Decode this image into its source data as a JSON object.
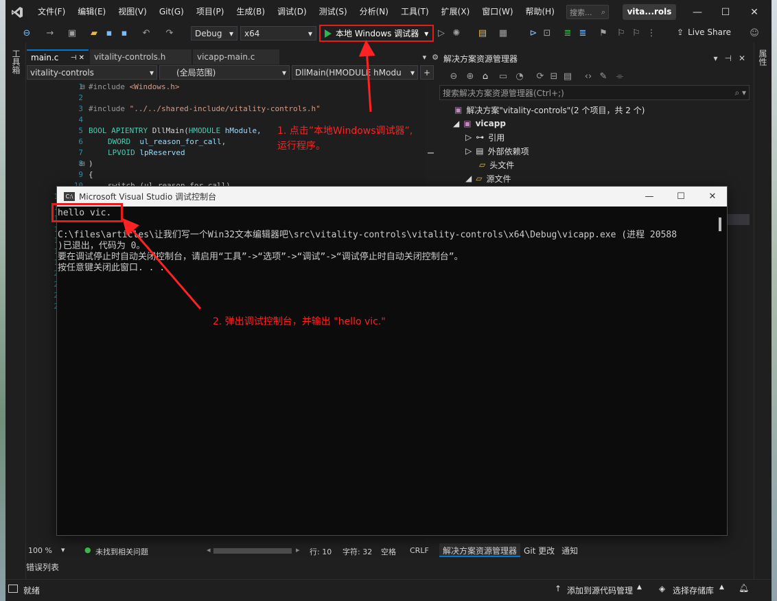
{
  "menu": [
    "文件(F)",
    "编辑(E)",
    "视图(V)",
    "Git(G)",
    "项目(P)",
    "生成(B)",
    "调试(D)",
    "测试(S)",
    "分析(N)",
    "工具(T)",
    "扩展(X)",
    "窗口(W)",
    "帮助(H)"
  ],
  "search_label": "搜索...",
  "title_tag": "vita...rols",
  "toolbar": {
    "config": "Debug",
    "platform": "x64",
    "run_label": "本地 Windows 调试器",
    "live_share": "Live Share"
  },
  "left_strip_label": "工具箱",
  "right_strip_label": "属性",
  "editor": {
    "tabs": [
      "main.c",
      "vitality-controls.h",
      "vicapp-main.c"
    ],
    "nav_project": "vitality-controls",
    "nav_scope": "(全局范围)",
    "nav_function": "DllMain(HMODULE hModu",
    "line_numbers": [
      "1",
      "2",
      "3",
      "4",
      "5",
      "6",
      "7",
      "8",
      "9",
      "10"
    ],
    "line_numbers_partial": [
      "1",
      "1",
      "1",
      "1",
      "1",
      "1",
      "1",
      "2",
      "2",
      "2",
      "2"
    ],
    "code": {
      "l1_pre": "#include ",
      "l1_arg": "<Windows.h>",
      "l3_pre": "#include ",
      "l3_arg": "\"../../shared-include/vitality-controls.h\"",
      "l5_type": "BOOL",
      "l5_api": "APIENTRY",
      "l5_func": "DllMain(",
      "l5_ptype": "HMODULE",
      "l5_param": "hModule,",
      "l6_type": "DWORD",
      "l6_param": "ul_reason_for_call,",
      "l7_type": "LPVOID",
      "l7_param": "lpReserved",
      "l8": ")",
      "l9": "{",
      "l10": "switch (ul_reason_for_call)"
    },
    "zoom": "100 %",
    "issues": "未找到相关问题",
    "line_col": "行: 10",
    "char_col": "字符: 32",
    "whitespace": "空格",
    "eol": "CRLF"
  },
  "error_list": "错误列表",
  "solution_explorer": {
    "title": "解决方案资源管理器",
    "search_placeholder": "搜索解决方案资源管理器(Ctrl+;)",
    "solution": "解决方案\"vitality-controls\"(2 个项目，共 2 个)",
    "items": [
      "vicapp",
      "引用",
      "外部依赖项",
      "头文件",
      "源文件"
    ],
    "bottom_tabs": [
      "解决方案资源管理器",
      "Git 更改",
      "通知"
    ]
  },
  "console": {
    "title": "Microsoft Visual Studio 调试控制台",
    "icon": "C:\\",
    "lines": [
      "hello vic.",
      "",
      "C:\\files\\articles\\让我们写一个Win32文本编辑器吧\\src\\vitality-controls\\vitality-controls\\x64\\Debug\\vicapp.exe (进程 20588",
      ")已退出，代码为 0。",
      "要在调试停止时自动关闭控制台，请启用“工具”->“选项”->“调试”->“调试停止时自动关闭控制台”。",
      "按任意键关闭此窗口. . ."
    ]
  },
  "annotations": {
    "step1_line1": "1. 点击”本地Windows调试器”,",
    "step1_line2": "运行程序。",
    "step2": "2. 弹出调试控制台，并输出 \"hello vic.\"",
    "color": "#ff2222"
  },
  "statusbar": {
    "ready": "就绪",
    "add_source": "添加到源代码管理",
    "select_repo": "选择存储库"
  }
}
